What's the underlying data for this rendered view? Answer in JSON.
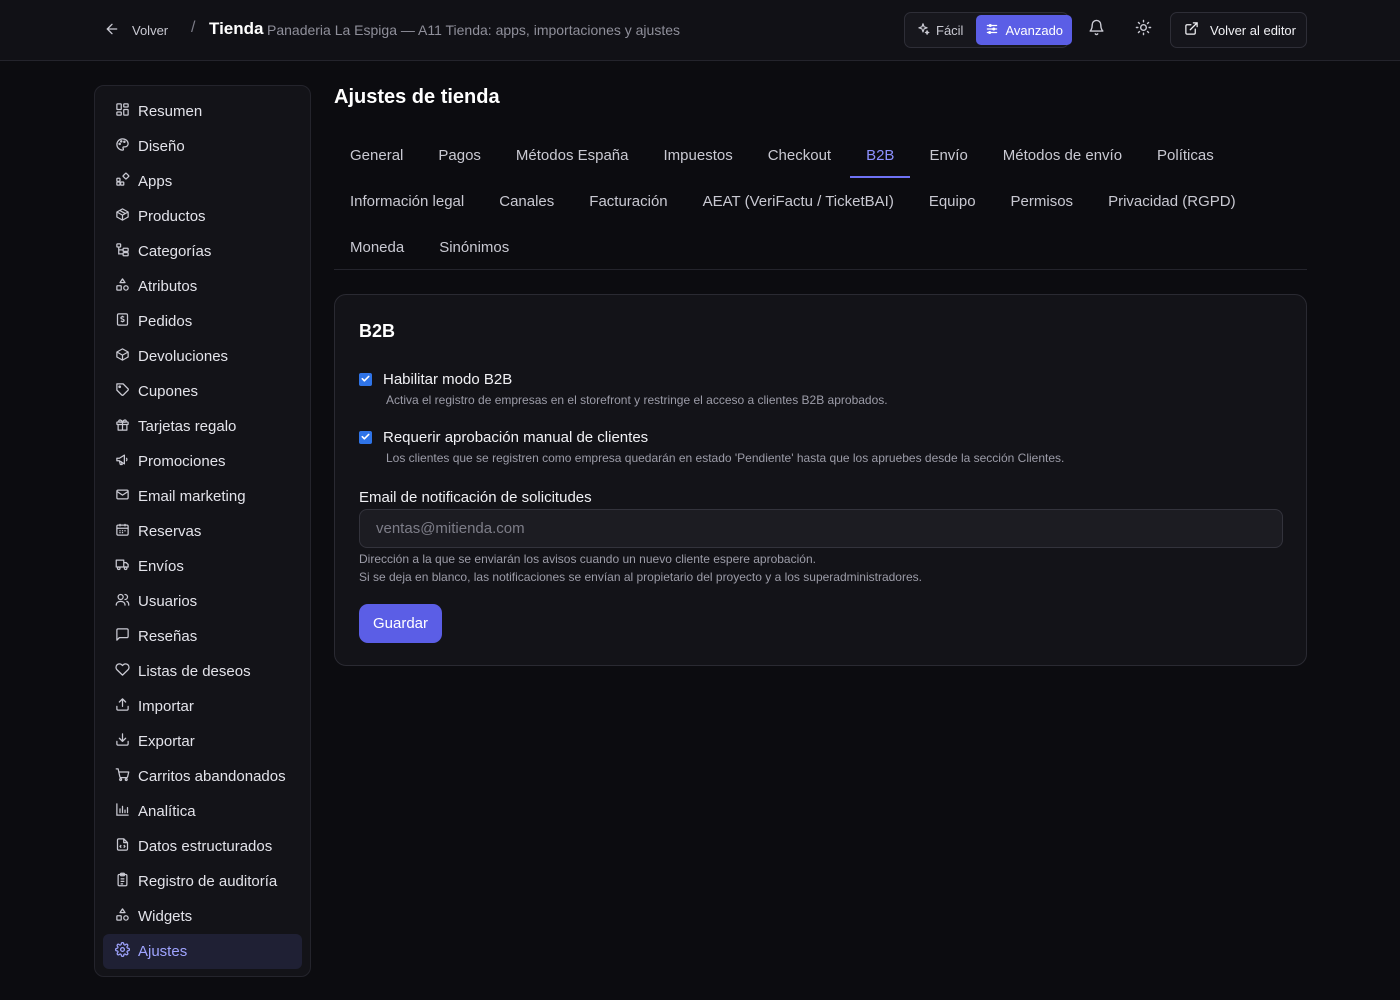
{
  "header": {
    "back_label": "Volver",
    "separator": "/",
    "title": "Tienda",
    "subtitle": "Panaderia La Espiga — A11 Tienda: apps, importaciones y ajustes",
    "mode_easy_label": "Fácil",
    "mode_advanced_label": "Avanzado",
    "active_mode": "Avanzado",
    "editor_button_label": "Volver al editor",
    "icons": [
      "arrow-left-icon",
      "sparkles-icon",
      "sliders-icon",
      "bell-icon",
      "sun-icon",
      "external-link-icon"
    ]
  },
  "sidebar": {
    "active_item": "Ajustes",
    "items": [
      {
        "label": "Resumen",
        "icon": "dashboard-icon"
      },
      {
        "label": "Diseño",
        "icon": "palette-icon"
      },
      {
        "label": "Apps",
        "icon": "apps-icon"
      },
      {
        "label": "Productos",
        "icon": "package-icon"
      },
      {
        "label": "Categorías",
        "icon": "hierarchy-icon"
      },
      {
        "label": "Atributos",
        "icon": "shapes-icon"
      },
      {
        "label": "Pedidos",
        "icon": "receipt-icon"
      },
      {
        "label": "Devoluciones",
        "icon": "package-return-icon"
      },
      {
        "label": "Cupones",
        "icon": "tag-icon"
      },
      {
        "label": "Tarjetas regalo",
        "icon": "gift-icon"
      },
      {
        "label": "Promociones",
        "icon": "megaphone-icon"
      },
      {
        "label": "Email marketing",
        "icon": "mail-icon"
      },
      {
        "label": "Reservas",
        "icon": "calendar-icon"
      },
      {
        "label": "Envíos",
        "icon": "truck-icon"
      },
      {
        "label": "Usuarios",
        "icon": "users-icon"
      },
      {
        "label": "Reseñas",
        "icon": "message-icon"
      },
      {
        "label": "Listas de deseos",
        "icon": "heart-icon"
      },
      {
        "label": "Importar",
        "icon": "upload-icon"
      },
      {
        "label": "Exportar",
        "icon": "download-icon"
      },
      {
        "label": "Carritos abandonados",
        "icon": "cart-icon"
      },
      {
        "label": "Analítica",
        "icon": "bar-chart-icon"
      },
      {
        "label": "Datos estructurados",
        "icon": "file-code-icon"
      },
      {
        "label": "Registro de auditoría",
        "icon": "clipboard-icon"
      },
      {
        "label": "Widgets",
        "icon": "shapes-icon"
      },
      {
        "label": "Ajustes",
        "icon": "gear-icon"
      }
    ]
  },
  "main": {
    "page_title": "Ajustes de tienda",
    "active_tab": "B2B",
    "tab_rows": [
      [
        "General",
        "Pagos",
        "Métodos España",
        "Impuestos",
        "Checkout",
        "B2B",
        "Envío",
        "Métodos de envío",
        "Políticas"
      ],
      [
        "Información legal",
        "Canales",
        "Facturación",
        "AEAT (VeriFactu / TicketBAI)",
        "Equipo",
        "Permisos",
        "Privacidad (RGPD)"
      ],
      [
        "Moneda",
        "Sinónimos"
      ]
    ]
  },
  "b2b": {
    "title": "B2B",
    "enable_b2b": {
      "label": "Habilitar modo B2B",
      "help": "Activa el registro de empresas en el storefront y restringe el acceso a clientes B2B aprobados.",
      "checked": true
    },
    "manual_approval": {
      "label": "Requerir aprobación manual de clientes",
      "help": "Los clientes que se registren como empresa quedarán en estado 'Pendiente' hasta que los apruebes desde la sección Clientes.",
      "checked": true
    },
    "notification_email": {
      "label": "Email de notificación de solicitudes",
      "value": "",
      "placeholder": "ventas@mitienda.com",
      "help_line1": "Dirección a la que se enviarán los avisos cuando un nuevo cliente espere aprobación.",
      "help_line2": "Si se deja en blanco, las notificaciones se envían al propietario del proyecto y a los superadministradores."
    },
    "save_label": "Guardar"
  },
  "colors": {
    "accent": "#5b5ee6",
    "accent_text": "#8d91ff",
    "checkbox": "#2f74e8",
    "background": "#0c0c10",
    "surface": "#131318"
  }
}
